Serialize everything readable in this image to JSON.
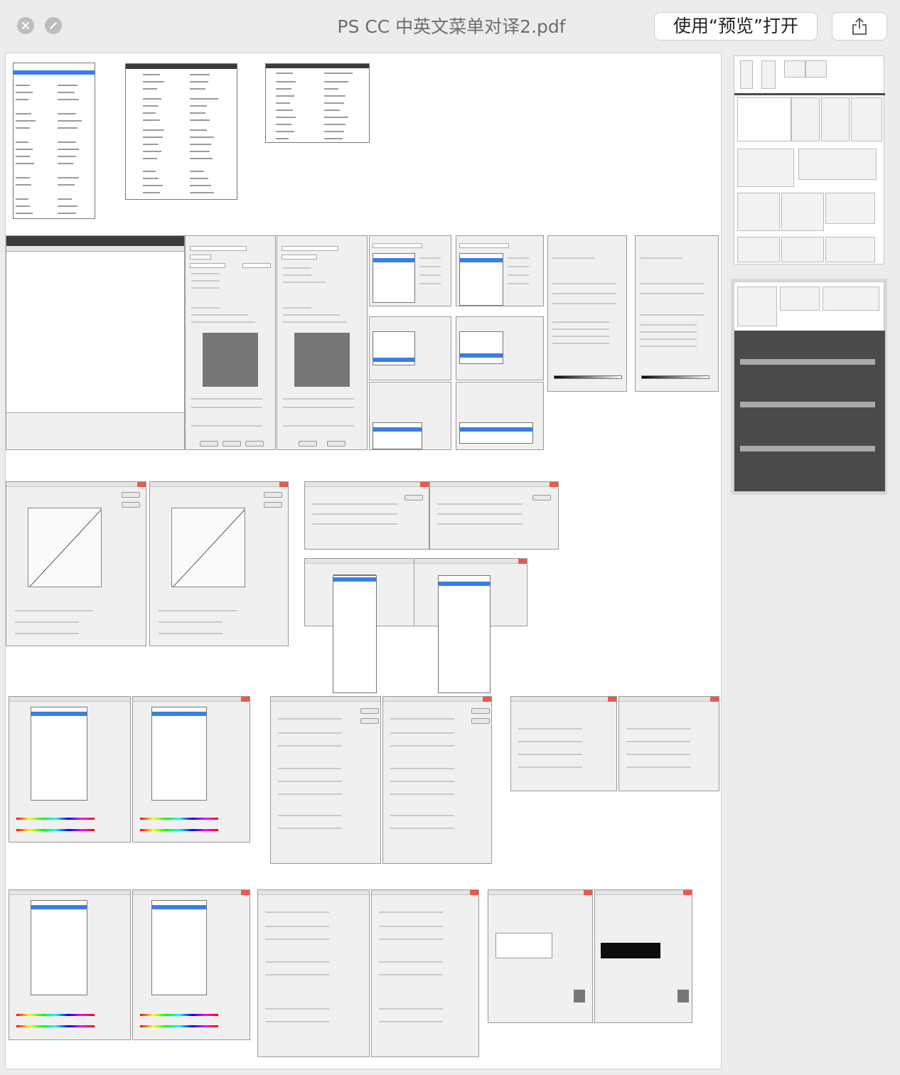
{
  "window": {
    "title": "PS CC 中英文菜单对译2.pdf",
    "open_button_label": "使用“预览”打开",
    "share_icon": "share-icon",
    "close_icon": "close-icon",
    "disabled_icon": "minimize-disabled-icon"
  },
  "sidebar": {
    "pages": [
      {
        "label": "page-1",
        "selected": false
      },
      {
        "label": "page-2",
        "selected": true
      }
    ]
  }
}
